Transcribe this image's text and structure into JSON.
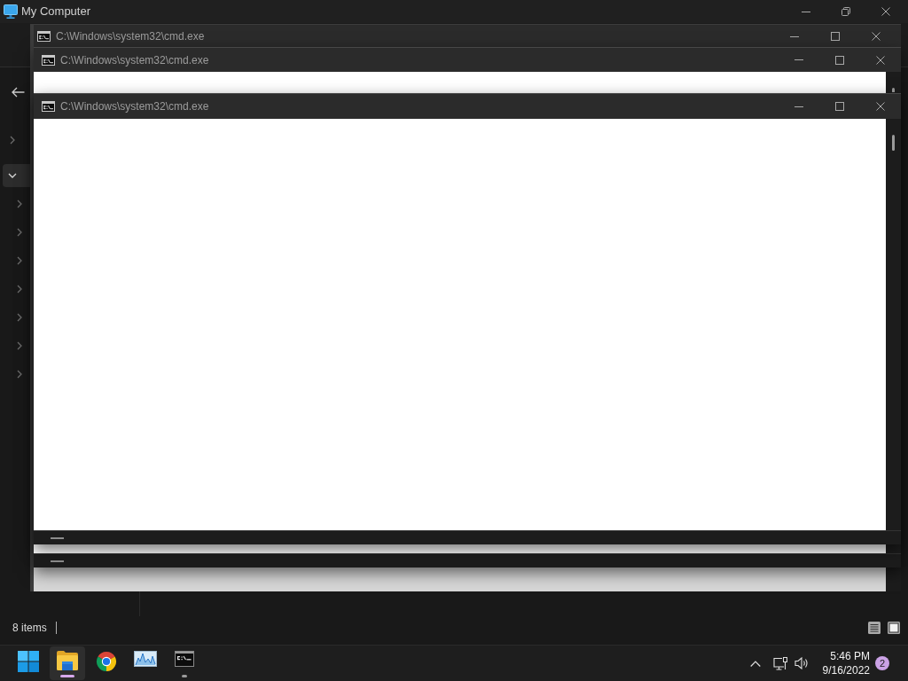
{
  "explorer": {
    "title": "My Computer",
    "nav": [
      {
        "expanded": false,
        "selected": false
      },
      {
        "expanded": true,
        "selected": true,
        "children": [
          {
            "expanded": false,
            "selected": false
          },
          {
            "expanded": false,
            "selected": false
          },
          {
            "expanded": false,
            "selected": false
          },
          {
            "expanded": false,
            "selected": false
          },
          {
            "expanded": false,
            "selected": false
          },
          {
            "expanded": false,
            "selected": false
          },
          {
            "expanded": false,
            "selected": false
          }
        ]
      }
    ],
    "status_bar": {
      "item_count": "8 items",
      "views": [
        {
          "kind": "details"
        },
        {
          "kind": "preview"
        }
      ]
    }
  },
  "windows": [
    {
      "title": "C:\\Windows\\system32\\cmd.exe"
    },
    {
      "title": "C:\\Windows\\system32\\cmd.exe"
    },
    {
      "title": "C:\\Windows\\system32\\cmd.exe"
    }
  ],
  "taskbar": {
    "apps": [
      {
        "kind": "start",
        "selected": false,
        "running": false
      },
      {
        "kind": "explorer",
        "selected": true,
        "running": true
      },
      {
        "kind": "browser",
        "selected": false,
        "running": false
      },
      {
        "kind": "monitor",
        "selected": false,
        "running": false
      },
      {
        "kind": "terminal",
        "selected": false,
        "running": true
      }
    ],
    "clock": {
      "time": "5:46 PM",
      "date": "9/16/2022"
    },
    "notification_count": "2"
  }
}
